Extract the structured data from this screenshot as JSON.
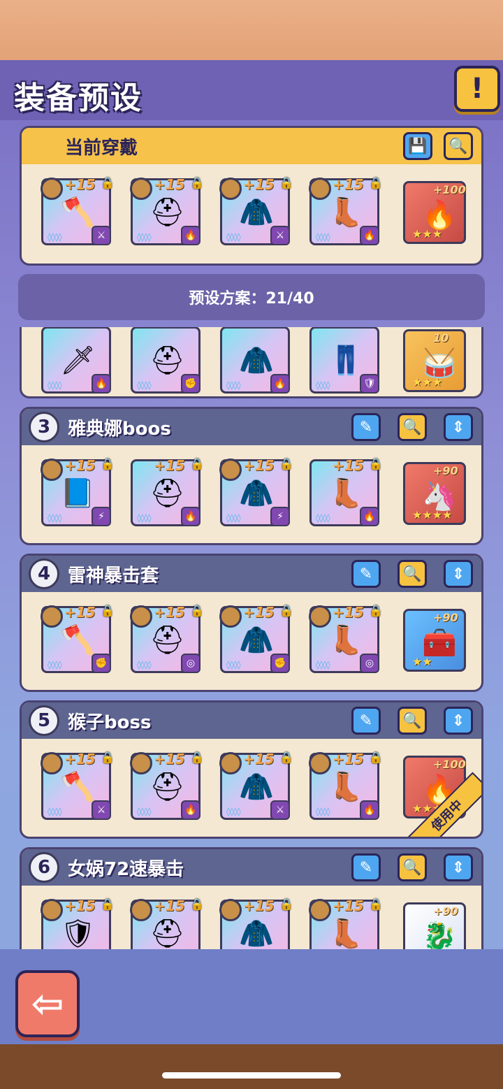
{
  "header": {
    "title": "装备预设",
    "info_icon": "!"
  },
  "current": {
    "title": "当前穿戴",
    "items": [
      {
        "level": "+15",
        "type": "⚔",
        "glyph": "🪓"
      },
      {
        "level": "+15",
        "type": "🔥",
        "glyph": "⛑"
      },
      {
        "level": "+15",
        "type": "⚔",
        "glyph": "🧥"
      },
      {
        "level": "+15",
        "type": "🔥",
        "glyph": "👢"
      }
    ],
    "relic": {
      "level": "+100",
      "stars": "★★★",
      "glyph": "🔥"
    }
  },
  "preset_count": "预设方案：21/40",
  "presets": [
    {
      "number": "3",
      "name": "雅典娜boos",
      "items": [
        {
          "level": "+15",
          "type": "⚡",
          "glyph": "📘"
        },
        {
          "level": "+15",
          "type": "🔥",
          "glyph": "⛑"
        },
        {
          "level": "+15",
          "type": "⚡",
          "glyph": "🧥"
        },
        {
          "level": "+15",
          "type": "🔥",
          "glyph": "👢"
        }
      ],
      "relic": {
        "level": "+90",
        "stars": "★★★★",
        "glyph": "🦄"
      }
    },
    {
      "number": "4",
      "name": "雷神暴击套",
      "items": [
        {
          "level": "+15",
          "type": "✊",
          "glyph": "🪓"
        },
        {
          "level": "+15",
          "type": "◎",
          "glyph": "⛑"
        },
        {
          "level": "+15",
          "type": "✊",
          "glyph": "🧥"
        },
        {
          "level": "+15",
          "type": "◎",
          "glyph": "👢"
        }
      ],
      "relic": {
        "level": "+90",
        "stars": "★★",
        "glyph": "🧰"
      }
    },
    {
      "number": "5",
      "name": "猴子boss",
      "items": [
        {
          "level": "+15",
          "type": "⚔",
          "glyph": "🪓"
        },
        {
          "level": "+15",
          "type": "🔥",
          "glyph": "⛑"
        },
        {
          "level": "+15",
          "type": "⚔",
          "glyph": "🧥"
        },
        {
          "level": "+15",
          "type": "🔥",
          "glyph": "👢"
        }
      ],
      "relic": {
        "level": "+100",
        "stars": "★★★",
        "glyph": "🔥"
      },
      "in_use": "使用中"
    },
    {
      "number": "6",
      "name": "女娲72速暴击",
      "items": [
        {
          "level": "+15",
          "type": "",
          "glyph": "🛡"
        },
        {
          "level": "+15",
          "type": "",
          "glyph": "⛑"
        },
        {
          "level": "+15",
          "type": "",
          "glyph": "🧥"
        },
        {
          "level": "+15",
          "type": "",
          "glyph": "👢"
        }
      ],
      "relic": {
        "level": "+90",
        "stars": "",
        "glyph": "🐉"
      }
    }
  ],
  "partial_preset": {
    "items": [
      {
        "glyph": "🗡",
        "type": "🔥"
      },
      {
        "glyph": "⛑",
        "type": "✊"
      },
      {
        "glyph": "🧥",
        "type": "🔥"
      },
      {
        "glyph": "👖",
        "type": "🛡"
      }
    ],
    "relic": {
      "level": "10",
      "stars": "★★★",
      "glyph": "🥁"
    }
  },
  "icons": {
    "save": "💾",
    "search": "🔍",
    "edit": "✎",
    "sort": "⇕",
    "lock": "🔒",
    "back": "⇦"
  }
}
